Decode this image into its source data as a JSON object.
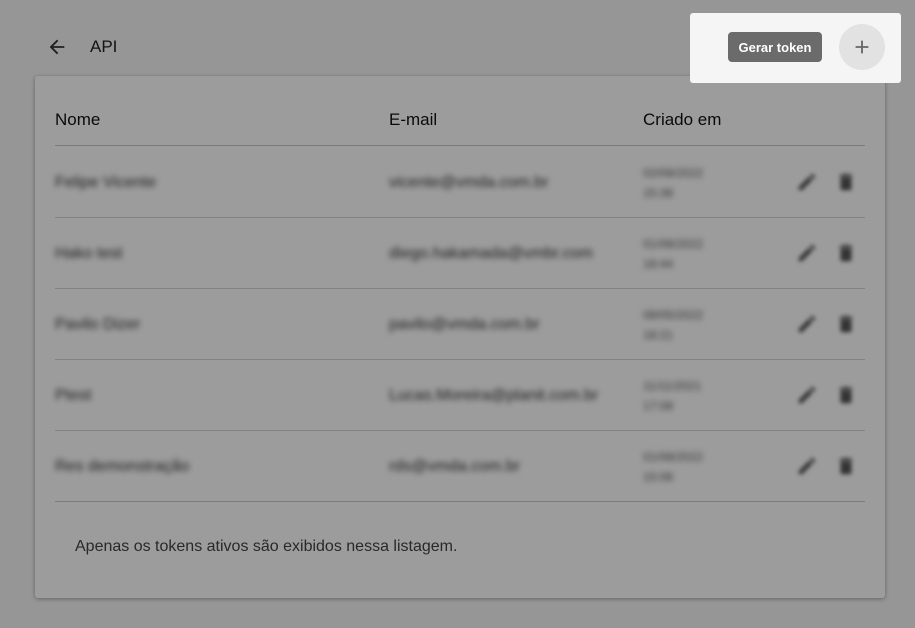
{
  "header": {
    "title": "API",
    "back_icon": "arrow-left-icon"
  },
  "toolbar": {
    "generate_token_label": "Gerar token",
    "add_icon": "plus-icon"
  },
  "table": {
    "columns": [
      "Nome",
      "E-mail",
      "Criado em"
    ],
    "rows": [
      {
        "nome": "Felipe Vicente",
        "email": "vicente@vmda.com.br",
        "date": "02/08/2022",
        "time": "15:38"
      },
      {
        "nome": "Hako test",
        "email": "diego.hakamada@vmbr.com",
        "date": "01/08/2022",
        "time": "18:44"
      },
      {
        "nome": "Pavilo Dizer",
        "email": "pavilo@vmda.com.br",
        "date": "08/05/2022",
        "time": "18:21"
      },
      {
        "nome": "Ptest",
        "email": "Lucas.Moreira@planit.com.br",
        "date": "11/11/2021",
        "time": "17:08"
      },
      {
        "nome": "Res demonstração",
        "email": "rds@vmda.com.br",
        "date": "01/08/2022",
        "time": "15:08"
      }
    ],
    "row_actions": [
      "pencil-icon",
      "trash-icon"
    ]
  },
  "footer_note": "Apenas os tokens ativos são exibidos nessa listagem.",
  "colors": {
    "overlay": "rgba(0,0,0,0.39)",
    "button_bg": "#6b6b6b",
    "background": "#f5f5f5"
  }
}
